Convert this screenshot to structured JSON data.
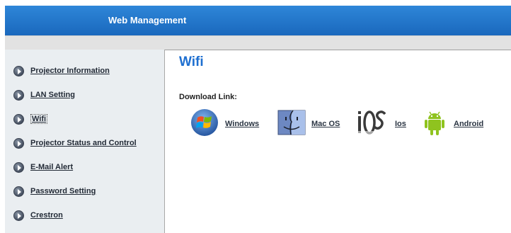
{
  "header": {
    "title": "Web Management"
  },
  "sidebar": {
    "items": [
      {
        "label": "Projector Information"
      },
      {
        "label": "LAN Setting"
      },
      {
        "label": "Wifi"
      },
      {
        "label": "Projector Status and Control"
      },
      {
        "label": "E-Mail Alert"
      },
      {
        "label": "Password Setting"
      },
      {
        "label": "Crestron"
      }
    ],
    "active_item": "Wifi"
  },
  "main": {
    "title": "Wifi",
    "download_label": "Download Link:",
    "downloads": [
      {
        "icon": "windows-logo-icon",
        "label": "Windows"
      },
      {
        "icon": "mac-os-finder-icon",
        "label": "Mac OS"
      },
      {
        "icon": "ios-logo-icon",
        "label": "Ios"
      },
      {
        "icon": "android-robot-icon",
        "label": "Android"
      }
    ]
  },
  "colors": {
    "header_blue": "#1f72c8",
    "title_blue": "#1e6fd0",
    "sidebar_bg": "#eaeef1"
  }
}
